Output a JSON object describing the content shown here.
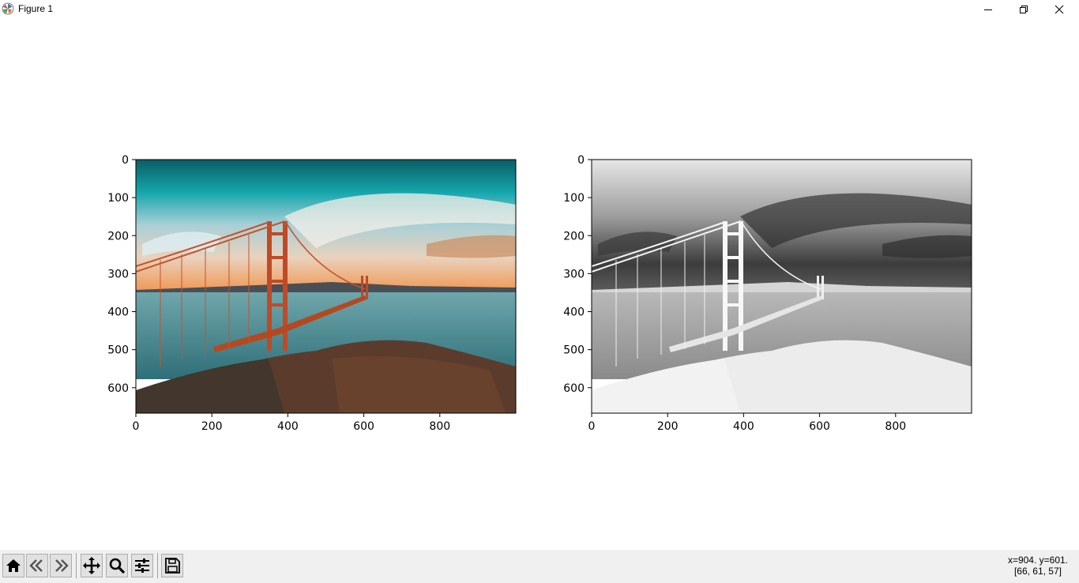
{
  "window": {
    "title": "Figure 1",
    "icon": "matplotlib-logo-icon",
    "controls": [
      "minimize-icon",
      "restore-icon",
      "close-icon"
    ]
  },
  "figure": {
    "subplots": [
      {
        "image": "Golden Gate Bridge color photo, teal sky, orange sunset",
        "xticks": [
          "0",
          "200",
          "400",
          "600",
          "800"
        ],
        "yticks": [
          "0",
          "100",
          "200",
          "300",
          "400",
          "500",
          "600"
        ],
        "xlim": [
          0,
          999
        ],
        "ylim": [
          666,
          0
        ]
      },
      {
        "image": "Inverted grayscale Golden Gate Bridge photo",
        "xticks": [
          "0",
          "200",
          "400",
          "600",
          "800"
        ],
        "yticks": [
          "0",
          "100",
          "200",
          "300",
          "400",
          "500",
          "600"
        ],
        "xlim": [
          0,
          999
        ],
        "ylim": [
          666,
          0
        ]
      }
    ]
  },
  "toolbar": {
    "buttons": [
      "home-icon",
      "back-icon",
      "forward-icon",
      "pan-icon",
      "zoom-icon",
      "configure-subplots-icon",
      "save-icon"
    ]
  },
  "status": {
    "coords": "x=904. y=601.",
    "pixel_value": "[66, 61, 57]"
  }
}
